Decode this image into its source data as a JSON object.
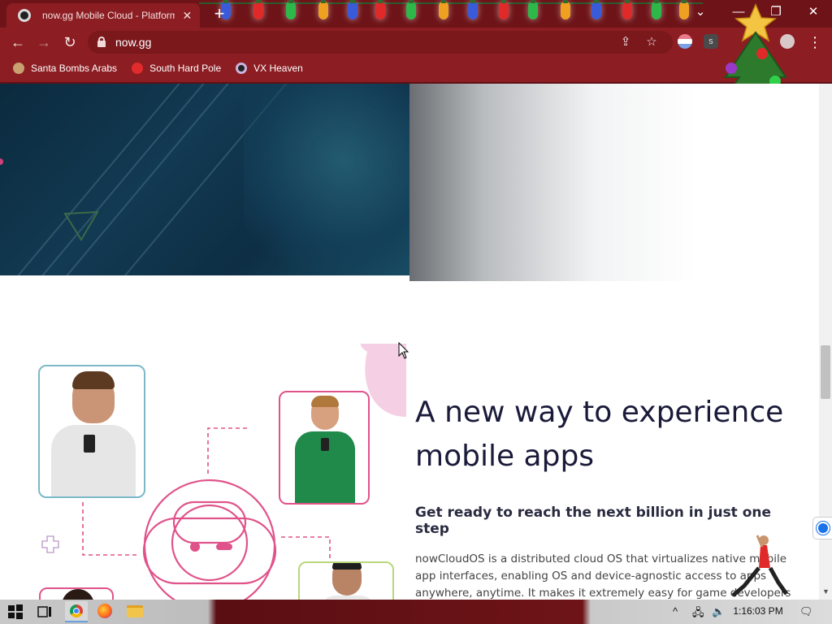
{
  "browser": {
    "tab_title": "now.gg Mobile Cloud - Platform",
    "url": "now.gg",
    "bookmarks": [
      {
        "label": "Santa Bombs Arabs",
        "icon": "santa-icon"
      },
      {
        "label": "South Hard Pole",
        "icon": "flower-icon"
      },
      {
        "label": "VX Heaven",
        "icon": "eye-icon"
      }
    ],
    "extension_badge": "s",
    "window_controls": {
      "minimize": "—",
      "restore": "❐",
      "close": "✕"
    },
    "tab_search": "⌄",
    "new_tab": "+",
    "nav": {
      "back": "←",
      "forward": "→",
      "reload": "↻"
    },
    "share_glyph": "⇪",
    "star_glyph": "☆",
    "menu_glyph": "⋮",
    "colors": {
      "chrome": "#8c1d22",
      "tabstrip": "#6e1418"
    }
  },
  "page": {
    "headline": "A new way to experience mobile apps",
    "subheadline": "Get ready to reach the next billion in just one step",
    "body": "nowCloudOS is a distributed cloud OS that virtualizes native mobile app interfaces, enabling OS and device-agnostic access to apps anywhere, anytime. It makes it extremely easy for game developers",
    "accent_color": "#e0538a"
  },
  "taskbar": {
    "time": "1:16:03 PM",
    "tray_up": "^",
    "volume_glyph": "🔈",
    "network_glyph": "🖧",
    "notification_glyph": "🗨"
  }
}
